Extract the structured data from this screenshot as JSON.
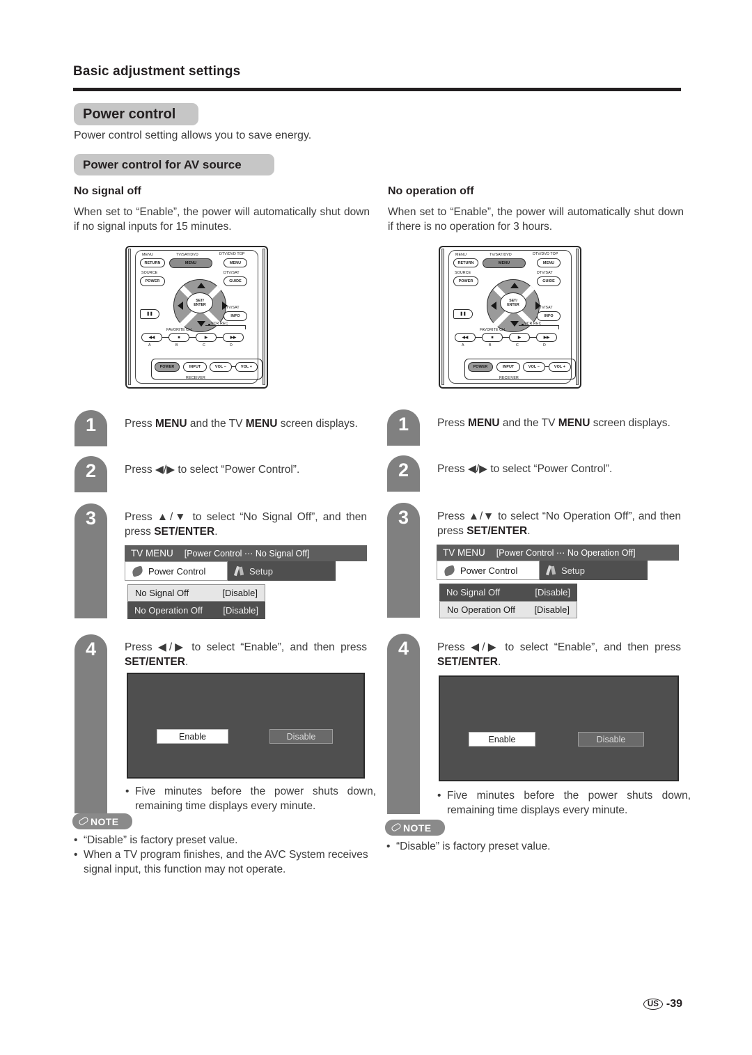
{
  "header": {
    "title": "Basic adjustment settings"
  },
  "section": {
    "power_control_chip": "Power control",
    "lead": "Power control setting allows you to save energy.",
    "av_source_chip": "Power control for AV source"
  },
  "columns": [
    {
      "heading": "No signal off",
      "intro": "When set to “Enable”, the power will automatically shut down if no signal inputs for 15 minutes.",
      "steps": [
        {
          "number": "1",
          "text": "Press MENU and the TV MENU screen displays.",
          "bold_parts": [
            "MENU"
          ]
        },
        {
          "number": "2",
          "text": "Press ◀/▶ to select “Power Control”."
        },
        {
          "number": "3",
          "text": "Press ▲/▼ to select “No Signal Off”, and then press SET/ENTER.",
          "bold_parts": [
            "SET/ENTER"
          ]
        },
        {
          "number": "4",
          "text": "Press ◀/▶ to select “Enable”, and then press SET/ENTER.",
          "bold_parts": [
            "SET/ENTER"
          ]
        }
      ],
      "osd": {
        "title_main": "TV MENU",
        "title_path": "[Power Control ⋯ No Signal Off]",
        "tab_active": "Power Control",
        "tab_idle": "Setup",
        "rows": [
          {
            "label": "No Signal Off",
            "value": "[Disable]",
            "selected": true
          },
          {
            "label": "No Operation Off",
            "value": "[Disable]",
            "selected": false
          }
        ]
      },
      "dialog": {
        "enable": "Enable",
        "disable": "Disable",
        "selected": "Enable"
      },
      "after_bullet": "Five minutes before the power shuts down, remaining time displays every minute.",
      "note_label": "NOTE",
      "notes": [
        "“Disable” is factory preset value.",
        "When a TV program finishes, and the AVC System receives signal input, this function may not operate."
      ]
    },
    {
      "heading": "No operation off",
      "intro": "When set to “Enable”, the power will automatically shut down if there is no operation for 3 hours.",
      "steps": [
        {
          "number": "1",
          "text": "Press MENU and the TV MENU screen displays.",
          "bold_parts": [
            "MENU"
          ]
        },
        {
          "number": "2",
          "text": "Press ◀/▶ to select “Power Control”."
        },
        {
          "number": "3",
          "text": "Press ▲/▼ to select “No Operation Off”, and then press SET/ENTER.",
          "bold_parts": [
            "SET/ENTER"
          ]
        },
        {
          "number": "4",
          "text": "Press ◀/▶ to select “Enable”, and then press SET/ENTER.",
          "bold_parts": [
            "SET/ENTER"
          ]
        }
      ],
      "osd": {
        "title_main": "TV MENU",
        "title_path": "[Power Control ⋯ No Operation Off]",
        "tab_active": "Power Control",
        "tab_idle": "Setup",
        "rows": [
          {
            "label": "No Signal Off",
            "value": "[Disable]",
            "selected": false
          },
          {
            "label": "No Operation Off",
            "value": "[Disable]",
            "selected": true
          }
        ]
      },
      "dialog": {
        "enable": "Enable",
        "disable": "Disable",
        "selected": "Enable"
      },
      "after_bullet": "Five minutes before the power shuts down, remaining time displays every minute.",
      "note_label": "NOTE",
      "notes": [
        "“Disable” is factory preset value."
      ]
    }
  ],
  "remote": {
    "labels": {
      "menu_top_left": "MENU",
      "return": "RETURN",
      "tv_sat_dvd": "TV/SAT/DVD",
      "menu_center": "MENU",
      "dtv_dvd_top": "DTV/DVD TOP",
      "menu_right": "MENU",
      "source": "SOURCE",
      "power_top": "POWER",
      "dtv_sat_guide": "DTV/SAT",
      "guide": "GUIDE",
      "dtv_sat_info": "DTV/SAT",
      "info": "INFO",
      "set_enter_line1": "SET/",
      "set_enter_line2": "ENTER",
      "favorite_ch": "FAVORITE CH",
      "vcr_rec": "VCR REC",
      "a": "A",
      "b": "B",
      "c": "C",
      "d": "D",
      "power_bottom": "POWER",
      "input": "INPUT",
      "vol_minus": "VOL −",
      "vol_plus": "VOL +",
      "receiver": "RECEIVER"
    }
  },
  "footer": {
    "region": "US",
    "page": "-39"
  },
  "colors": {
    "chip_gray": "#c6c6c6",
    "step_gray": "#808080",
    "osd_dark": "#4f4f4f",
    "osd_title": "#5e5e5e",
    "rule_black": "#231f20"
  }
}
